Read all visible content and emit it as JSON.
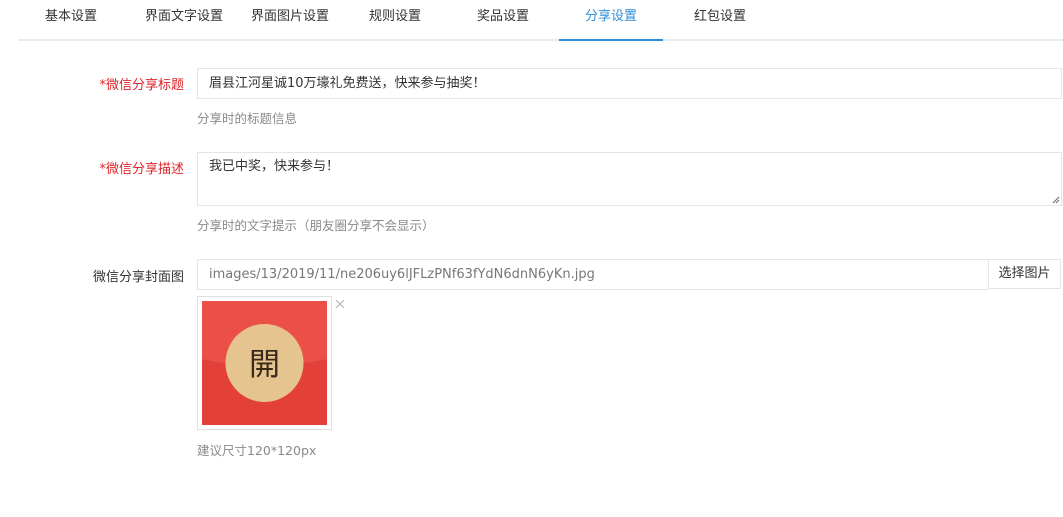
{
  "tabs": [
    {
      "label": "基本设置",
      "active": false
    },
    {
      "label": "界面文字设置",
      "active": false
    },
    {
      "label": "界面图片设置",
      "active": false
    },
    {
      "label": "规则设置",
      "active": false
    },
    {
      "label": "奖品设置",
      "active": false
    },
    {
      "label": "分享设置",
      "active": true
    },
    {
      "label": "红包设置",
      "active": false
    }
  ],
  "form": {
    "share_title": {
      "required_mark": "*",
      "label": "微信分享标题",
      "value": "眉县江河星诚10万壕礼免费送，快来参与抽奖！",
      "help": "分享时的标题信息"
    },
    "share_desc": {
      "required_mark": "*",
      "label": "微信分享描述",
      "value": "我已中奖，快来参与！",
      "help": "分享时的文字提示（朋友圈分享不会显示）"
    },
    "share_cover": {
      "label": "微信分享封面图",
      "value": "images/13/2019/11/ne206uy6lJFLzPNf63fYdN6dnN6yKn.jpg",
      "select_button": "选择图片",
      "thumbnail_glyph": "開",
      "thumbnail_icon": "red-envelope-icon",
      "remove_icon": "close-icon",
      "help": "建议尺寸120*120px"
    }
  },
  "colors": {
    "accent": "#2f8fd8",
    "required": "#e0242a",
    "envelope_red": "#e8453c",
    "envelope_seal": "#e6c48f"
  }
}
